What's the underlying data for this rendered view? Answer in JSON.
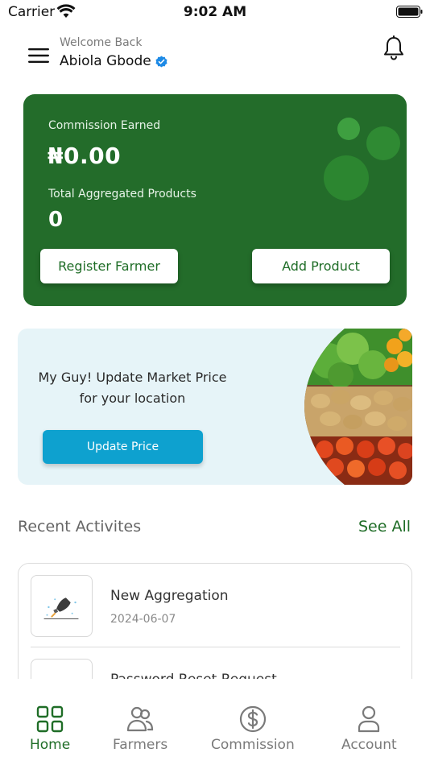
{
  "status_bar": {
    "carrier": "Carrier",
    "time": "9:02 AM"
  },
  "header": {
    "welcome": "Welcome Back",
    "user_name": "Abiola Gbode",
    "icons": [
      "menu-icon",
      "verified-badge-icon",
      "bell-icon"
    ]
  },
  "commission_card": {
    "commission_label": "Commission Earned",
    "commission_value": "₦0.00",
    "products_label": "Total Aggregated Products",
    "products_value": "0",
    "register_button": "Register Farmer",
    "add_product_button": "Add Product",
    "background_color": "#236c2a"
  },
  "market_banner": {
    "message_line1": "My Guy! Update Market Price",
    "message_line2": "for your location",
    "button_label": "Update Price",
    "button_color": "#0ea1cf",
    "image_icon": "vegetable-market-image"
  },
  "recent_activities": {
    "title": "Recent Activites",
    "see_all": "See All",
    "items": [
      {
        "title": "New Aggregation",
        "date": "2024-06-07",
        "icon": "rocket-icon"
      },
      {
        "title": "Password Reset Request",
        "date": "",
        "icon": "rocket-icon"
      }
    ]
  },
  "bottom_nav": {
    "items": [
      {
        "label": "Home",
        "icon": "home-grid-icon",
        "active": true
      },
      {
        "label": "Farmers",
        "icon": "farmers-icon",
        "active": false
      },
      {
        "label": "Commission",
        "icon": "dollar-icon",
        "active": false
      },
      {
        "label": "Account",
        "icon": "account-icon",
        "active": false
      }
    ],
    "active_color": "#1f6d27"
  }
}
